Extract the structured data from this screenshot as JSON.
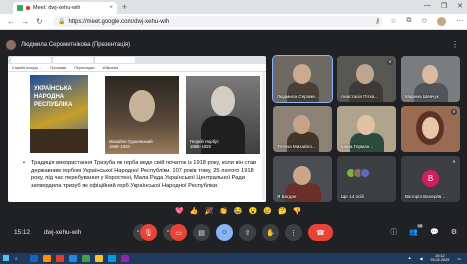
{
  "browser": {
    "tab_title": "Meet: dwj-xehu-wih",
    "new_tab_symbol": "+",
    "close_symbol": "×",
    "url": "https://meet.google.com/dwj-xehu-wih",
    "window_controls": [
      "—",
      "❐",
      "✕"
    ]
  },
  "presenter": {
    "name": "Людмила Серометнікова (Презентація)"
  },
  "shared_screen": {
    "tabs": [
      "Docs",
      "Presentation",
      ""
    ],
    "bookmarks": [
      "Служба пошуку ...",
      "Програми",
      "Перекладач",
      "Wikipedia"
    ],
    "pic1_label": "УКРАЇНСЬКА\nНАРОДНА\nРЕСПУБЛІКА",
    "pic2_caption": "Михайло Грушевський\n1866–1934",
    "pic3_caption": "Георгій Нарбут\n1886–1920",
    "slide_text": "Традиція використання Тризуба як герба веде свій початок із 1918 року, коли він став державним гербом Української Народної Республіки. 107 років тому, 25 лютого 1918 року, під час перебування у Коростені, Мала Рада Української Центральної Ради затвердила тризуб як офіційний герб Української Народної Республіки."
  },
  "participants": [
    {
      "name": "Людмила Сероме...",
      "speaking": true
    },
    {
      "name": "Анастасія Пітка...",
      "speaking": false
    },
    {
      "name": "Марина Шевчук",
      "speaking": false
    },
    {
      "name": "Тетяна Михайло...",
      "speaking": false
    },
    {
      "name": "Ірина Герман...",
      "speaking": false
    },
    {
      "name": "",
      "speaking": false
    },
    {
      "name": "Я Богдан",
      "speaking": false
    },
    {
      "name": "Ще 14 осіб",
      "speaking": false
    },
    {
      "name": "Вікторія Валеріїв...",
      "speaking": false,
      "initial": "В"
    }
  ],
  "reactions": [
    "💖",
    "👍",
    "🎉",
    "👏",
    "😂",
    "😮",
    "😢",
    "🤔",
    "👎"
  ],
  "bottombar": {
    "time": "15:12",
    "meeting_code": "dwj-xehu-wih",
    "people_count": "19"
  },
  "taskbar": {
    "time": "15:12",
    "date": "25.02.2025"
  },
  "colors": {
    "background": "#202124",
    "hangup": "#ea4335",
    "active": "#8ab4f8"
  }
}
